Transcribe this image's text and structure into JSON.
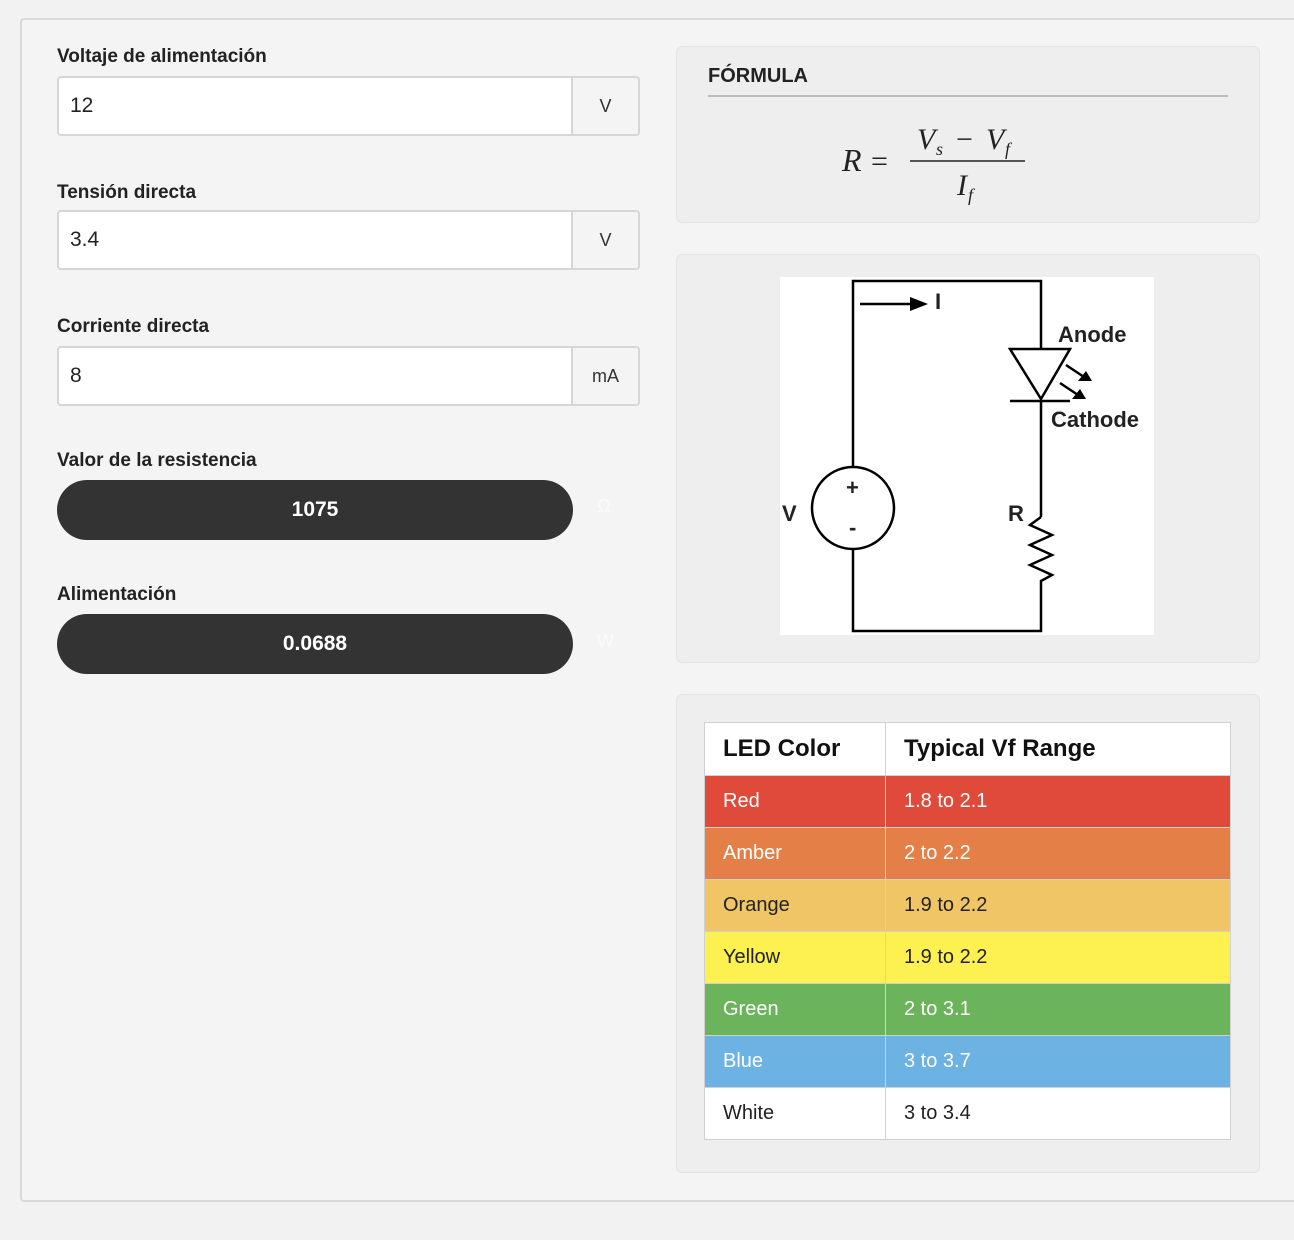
{
  "inputs": [
    {
      "label": "Voltaje de alimentación",
      "value": "12",
      "unit": "V"
    },
    {
      "label": "Tensión directa",
      "value": "3.4",
      "unit": "V"
    },
    {
      "label": "Corriente directa",
      "value": "8",
      "unit": "mA"
    }
  ],
  "results": [
    {
      "label": "Valor de la resistencia",
      "value": "1075",
      "unit": "Ω"
    },
    {
      "label": "Alimentación",
      "value": "0.0688",
      "unit": "W"
    }
  ],
  "formula": {
    "title": "FÓRMULA",
    "lhs": "R =",
    "numerator": "V_s − V_f",
    "denominator": "I_f"
  },
  "circuit": {
    "current_label": "I",
    "anode_label": "Anode",
    "cathode_label": "Cathode",
    "source_label": "V",
    "resistor_label": "R",
    "plus": "+",
    "minus": "-"
  },
  "led_table": {
    "headers": [
      "LED Color",
      "Typical Vf Range"
    ],
    "rows": [
      {
        "color": "Red",
        "range": "1.8 to 2.1",
        "bg": "#e04a3a",
        "fg": "#ffffff"
      },
      {
        "color": "Amber",
        "range": "2 to 2.2",
        "bg": "#e57f48",
        "fg": "#ffffff"
      },
      {
        "color": "Orange",
        "range": "1.9 to 2.2",
        "bg": "#f0c565",
        "fg": "#222222"
      },
      {
        "color": "Yellow",
        "range": "1.9 to 2.2",
        "bg": "#fdf151",
        "fg": "#222222"
      },
      {
        "color": "Green",
        "range": "2 to 3.1",
        "bg": "#6cb45c",
        "fg": "#ffffff"
      },
      {
        "color": "Blue",
        "range": "3 to 3.7",
        "bg": "#6cb3e3",
        "fg": "#ffffff"
      },
      {
        "color": "White",
        "range": "3 to 3.4",
        "bg": "#ffffff",
        "fg": "#222222"
      }
    ]
  },
  "colors": {
    "result_pill": "#333333",
    "panel_bg": "#f4f4f4",
    "card_bg": "#eeeeef"
  }
}
